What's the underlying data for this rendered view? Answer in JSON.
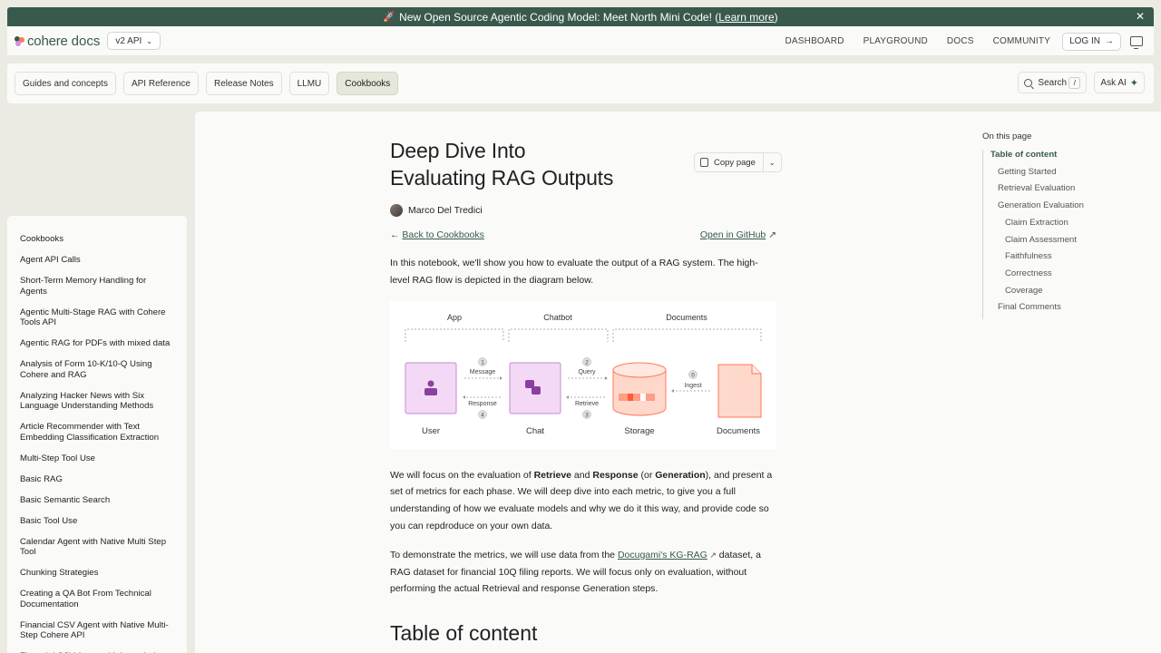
{
  "banner": {
    "icon": "rocket-icon",
    "text": "New Open Source Agentic Coding Model: Meet North Mini Code! (",
    "link": "Learn more",
    "suffix": ")",
    "close": "✕"
  },
  "topnav": {
    "logo_word": "cohere",
    "logo_docs": "docs",
    "version": "v2 API",
    "links": [
      "DASHBOARD",
      "PLAYGROUND",
      "DOCS",
      "COMMUNITY"
    ],
    "login": "LOG IN"
  },
  "tabs": [
    "Guides and concepts",
    "API Reference",
    "Release Notes",
    "LLMU",
    "Cookbooks"
  ],
  "active_tab": "Cookbooks",
  "search": {
    "label": "Search",
    "shortcut": "/"
  },
  "ask": {
    "label": "Ask AI"
  },
  "sidebar": {
    "items": [
      "Cookbooks",
      "Agent API Calls",
      "Short-Term Memory Handling for Agents",
      "Agentic Multi-Stage RAG with Cohere Tools API",
      "Agentic RAG for PDFs with mixed data",
      "Analysis of Form 10-K/10-Q Using Cohere and RAG",
      "Analyzing Hacker News with Six Language Understanding Methods",
      "Article Recommender with Text Embedding Classification Extraction",
      "Multi-Step Tool Use",
      "Basic RAG",
      "Basic Semantic Search",
      "Basic Tool Use",
      "Calendar Agent with Native Multi Step Tool",
      "Chunking Strategies",
      "Creating a QA Bot From Technical Documentation",
      "Financial CSV Agent with Native Multi-Step Cohere API",
      "Financial CSV Agent with Langchain"
    ]
  },
  "article": {
    "title_line1": "Deep Dive Into",
    "title_line2": "Evaluating RAG Outputs",
    "copy_page": "Copy page",
    "author": "Marco Del Tredici",
    "back": "Back to Cookbooks",
    "github": "Open in GitHub",
    "intro": "In this notebook, we'll show you how to evaluate the output of a RAG system. The high-level RAG flow is depicted in the diagram below.",
    "p2": {
      "t1": "We will focus on the evaluation of ",
      "b1": "Retrieve",
      "t2": " and ",
      "b2": "Response",
      "t3": " (or ",
      "b3": "Generation",
      "t4": "), and present a set of metrics for each phase. We will deep dive into each metric, to give you a full understanding of how we evaluate models and why we do it this way, and provide code so you can repdroduce on your own data."
    },
    "p3": {
      "t1": "To demonstrate the metrics, we will use data from the ",
      "link": "Docugami's KG-RAG",
      "t2": " dataset, a RAG dataset for financial 10Q filing reports. We will focus only on evaluation, without performing the actual Retrieval and response Generation steps."
    },
    "next_heading": "Table of content"
  },
  "diagram": {
    "groups": [
      "App",
      "Chatbot",
      "Documents"
    ],
    "nodes": [
      "User",
      "Chat",
      "Storage",
      "Documents"
    ],
    "arrows": [
      {
        "num": "1",
        "label": "Message"
      },
      {
        "num": "4",
        "label": "Response"
      },
      {
        "num": "2",
        "label": "Query"
      },
      {
        "num": "3",
        "label": "Retrieve"
      },
      {
        "num": "0",
        "label": "Ingest"
      }
    ]
  },
  "toc": {
    "heading": "On this page",
    "items": [
      {
        "label": "Table of content",
        "level": 0,
        "active": true
      },
      {
        "label": "Getting Started",
        "level": 1
      },
      {
        "label": "Retrieval Evaluation",
        "level": 1
      },
      {
        "label": "Generation Evaluation",
        "level": 1
      },
      {
        "label": "Claim Extraction",
        "level": 2
      },
      {
        "label": "Claim Assessment",
        "level": 2
      },
      {
        "label": "Faithfulness",
        "level": 2
      },
      {
        "label": "Correctness",
        "level": 2
      },
      {
        "label": "Coverage",
        "level": 2
      },
      {
        "label": "Final Comments",
        "level": 1
      }
    ]
  },
  "colors": {
    "brand": "#39594d",
    "accent_coral": "#ff7759",
    "accent_purple": "#d18ee2"
  }
}
